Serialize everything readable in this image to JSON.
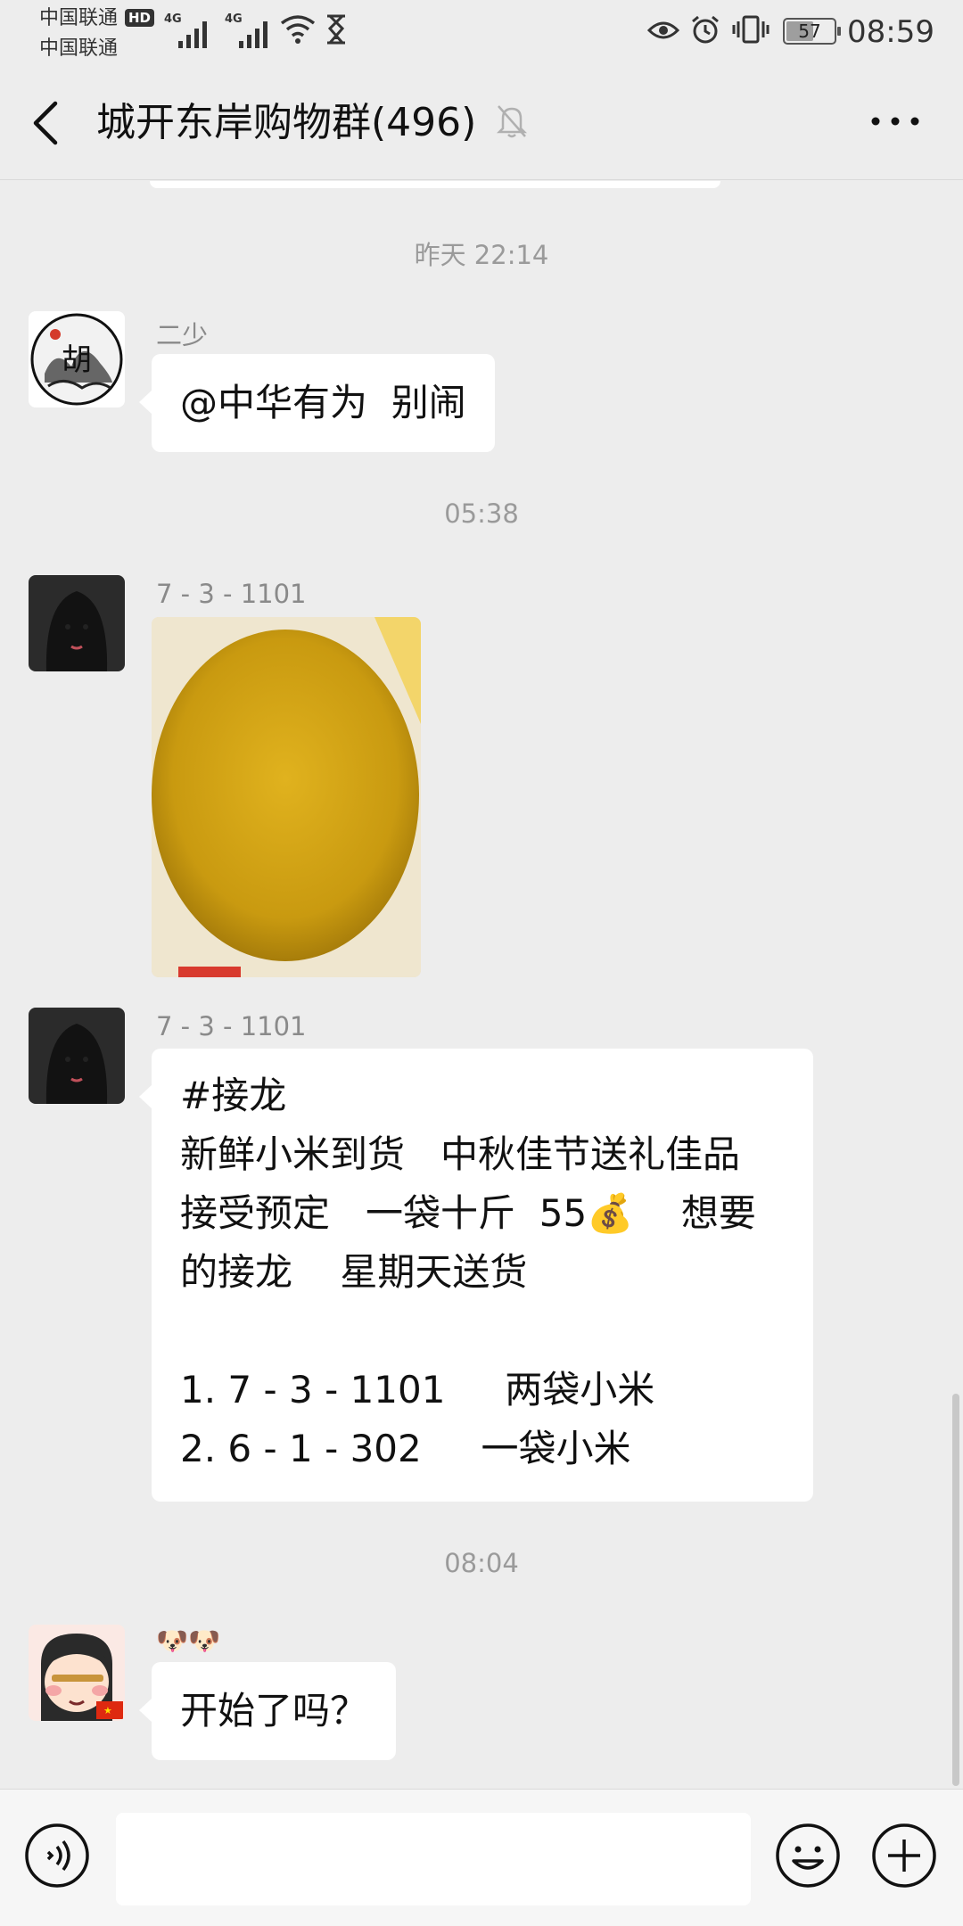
{
  "status_bar": {
    "carrier_1": "中国联通",
    "carrier_2": "中国联通",
    "hd": "HD",
    "network_1": "4G",
    "network_2": "4G",
    "battery": "57",
    "battery_level": 0.57,
    "time": "08:59"
  },
  "header": {
    "title": "城开东岸购物群(496)",
    "icons": [
      "back-icon",
      "mute-icon",
      "more-icon"
    ]
  },
  "messages": [
    {
      "type": "time",
      "text": "昨天 22:14"
    },
    {
      "type": "text",
      "sender": "二少",
      "lines": [
        "@中华有为  别闹"
      ]
    },
    {
      "type": "time",
      "text": "05:38"
    },
    {
      "type": "image",
      "sender": "7 - 3 - 1101",
      "image": "millet-in-bag-photo"
    },
    {
      "type": "text",
      "sender": "7 - 3 - 1101",
      "lines": [
        "#接龙",
        "新鲜小米到货   中秋佳节送礼佳品",
        "接受预定   一袋十斤  55💰    想要",
        "的接龙    星期天送货",
        "",
        "1. 7 - 3 - 1101     两袋小米",
        "2. 6 - 1 - 302     一袋小米"
      ]
    },
    {
      "type": "time",
      "text": "08:04"
    },
    {
      "type": "text",
      "sender": "🐶🐶",
      "lines": [
        "开始了吗？"
      ]
    }
  ],
  "input_bar": {
    "text_value": "",
    "icons": [
      "voice-icon",
      "emoji-icon",
      "plus-icon"
    ]
  },
  "colors": {
    "background": "#ededed",
    "bubble": "#ffffff",
    "timestamp": "#9a9a9a",
    "sender": "#8a8a8a"
  }
}
